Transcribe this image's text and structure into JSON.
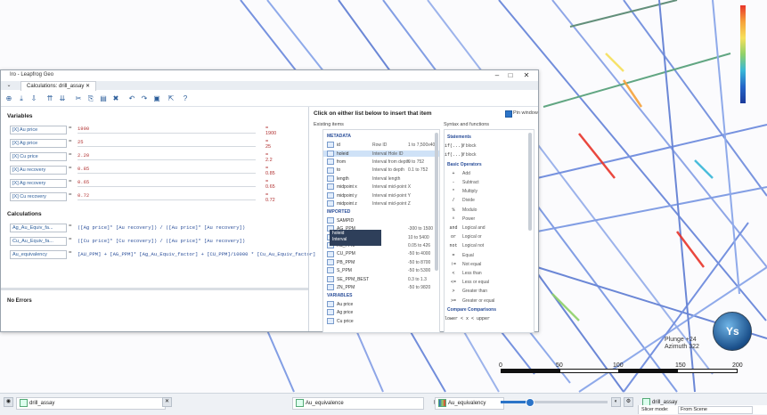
{
  "scene": {
    "plunge": "Plunge +24",
    "azimuth": "Azimuth 322",
    "scale_labels": [
      "0",
      "50",
      "100",
      "150",
      "200"
    ],
    "globe_label": "Ys"
  },
  "window": {
    "title": "Iro - Leapfrog Geo",
    "tab": "Calculations: drill_assay",
    "variables_header": "Variables",
    "calculations_header": "Calculations",
    "status": "No Errors",
    "click_hint": "Click on either list below to insert that item",
    "existing_items": "Existing items",
    "syntax_functions": "Syntax and functions",
    "pin_window": "Pin window"
  },
  "variables": [
    {
      "name": "Au price",
      "value": "1900",
      "result": "1900"
    },
    {
      "name": "Ag price",
      "value": "25",
      "result": "25"
    },
    {
      "name": "Cu price",
      "value": "2.20",
      "result": "2.2"
    },
    {
      "name": "Au recovery",
      "value": "0.85",
      "result": "0.85"
    },
    {
      "name": "Ag recovery",
      "value": "0.65",
      "result": "0.65"
    },
    {
      "name": "Cu recovery",
      "value": "0.72",
      "result": "0.72"
    }
  ],
  "calculations": [
    {
      "name": "Ag_Au_Equiv_fa...",
      "expr": "([Ag price]* [Au recovery]) / ([Au price]* [Au recovery])"
    },
    {
      "name": "Cu_Au_Equiv_fa...",
      "expr": "([Cu price]* [Cu recovery]) / ([Au price]* [Au recovery])"
    },
    {
      "name": "Au_equivalency",
      "expr": "[AU_PPM] + [AG_PPM]* [Ag_Au_Equiv_factor] + [CU_PPM]/10000 * [Cu_Au_Equiv_factor]"
    }
  ],
  "existing_items": [
    {
      "type": "grp",
      "name": "METADATA"
    },
    {
      "type": "item",
      "name": "id",
      "desc": "Row ID",
      "range": "1 to 7,500x404"
    },
    {
      "type": "item",
      "name": "holeid",
      "desc": "Interval Hole ID",
      "range": ""
    },
    {
      "type": "item",
      "name": "from",
      "desc": "Interval from depth",
      "range": "0 to 752"
    },
    {
      "type": "item",
      "name": "to",
      "desc": "Interval to depth",
      "range": "0.1 to 752"
    },
    {
      "type": "item",
      "name": "length",
      "desc": "Interval length",
      "range": ""
    },
    {
      "type": "item",
      "name": "midpoint x",
      "desc": "Interval mid-point X",
      "range": ""
    },
    {
      "type": "item",
      "name": "midpoint y",
      "desc": "Interval mid-point Y",
      "range": ""
    },
    {
      "type": "item",
      "name": "midpoint z",
      "desc": "Interval mid-point Z",
      "range": ""
    },
    {
      "type": "grp",
      "name": "IMPORTED"
    },
    {
      "type": "item",
      "name": "SAMPID",
      "desc": "",
      "range": ""
    },
    {
      "type": "item",
      "name": "AG_PPM",
      "desc": "",
      "range": "-300 to 1500"
    },
    {
      "type": "item",
      "name": "AU_PPM",
      "desc": "",
      "range": "10 to 5400"
    },
    {
      "type": "item",
      "name": "AS_PPM",
      "desc": "",
      "range": "0.05 to 426"
    },
    {
      "type": "item",
      "name": "CU_PPM",
      "desc": "",
      "range": "-50 to 4000"
    },
    {
      "type": "item",
      "name": "PB_PPM",
      "desc": "",
      "range": "-50 to 8700"
    },
    {
      "type": "item",
      "name": "S_PPM",
      "desc": "",
      "range": "-50 to 5300"
    },
    {
      "type": "item",
      "name": "SE_PPM_BEST",
      "desc": "",
      "range": "0.3 to 1.3"
    },
    {
      "type": "item",
      "name": "ZN_PPM",
      "desc": "",
      "range": "-50 to 9820"
    },
    {
      "type": "grp",
      "name": "VARIABLES"
    },
    {
      "type": "item",
      "name": "Au price",
      "desc": "",
      "range": ""
    },
    {
      "type": "item",
      "name": "Ag price",
      "desc": "",
      "range": ""
    },
    {
      "type": "item",
      "name": "Cu price",
      "desc": "",
      "range": ""
    }
  ],
  "tooltip": {
    "line1": "holeid",
    "line2": "Interval",
    "line3": "Hole ID"
  },
  "functions": [
    {
      "type": "grp",
      "name": "Statements"
    },
    {
      "type": "item",
      "op": "if(...)",
      "fn": "if block"
    },
    {
      "type": "item",
      "op": "if(...)",
      "fn": "if block"
    },
    {
      "type": "grp",
      "name": "Basic Operators"
    },
    {
      "type": "item",
      "op": "+",
      "fn": "Add"
    },
    {
      "type": "item",
      "op": "-",
      "fn": "Subtract"
    },
    {
      "type": "item",
      "op": "*",
      "fn": "Multiply"
    },
    {
      "type": "item",
      "op": "/",
      "fn": "Divide"
    },
    {
      "type": "item",
      "op": "%",
      "fn": "Modulo"
    },
    {
      "type": "item",
      "op": "^",
      "fn": "Power"
    },
    {
      "type": "item",
      "op": "and",
      "fn": "Logical and"
    },
    {
      "type": "item",
      "op": "or",
      "fn": "Logical or"
    },
    {
      "type": "item",
      "op": "not",
      "fn": "Logical not"
    },
    {
      "type": "item",
      "op": "=",
      "fn": "Equal"
    },
    {
      "type": "item",
      "op": "!=",
      "fn": "Not equal"
    },
    {
      "type": "item",
      "op": "<",
      "fn": "Less than"
    },
    {
      "type": "item",
      "op": "<=",
      "fn": "Less or equal"
    },
    {
      "type": "item",
      "op": ">",
      "fn": "Greater than"
    },
    {
      "type": "item",
      "op": ">=",
      "fn": "Greater or equal"
    },
    {
      "type": "grp",
      "name": "Compare Comparisons"
    },
    {
      "type": "item",
      "op": "lower < x < upper",
      "fn": ""
    }
  ],
  "bottombar": {
    "table": "drill_assay",
    "column": "Au_equivalence",
    "column2": "Au_equivalency",
    "right_title": "drill_assay",
    "slicer_label": "Slicer mode:",
    "slicer_value": "From Scene"
  },
  "colors": {
    "accent": "#2b74c8",
    "variable": "#b03030",
    "expression": "#2b4f9a"
  }
}
